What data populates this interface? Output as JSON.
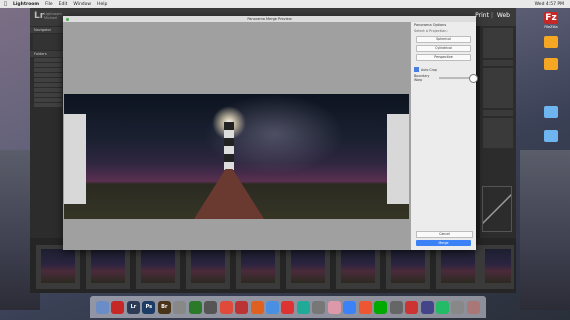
{
  "menubar": {
    "apple": "",
    "items": [
      "Lightroom",
      "File",
      "Edit",
      "Window",
      "Help"
    ],
    "clock": "Wed 4:57 PM"
  },
  "lightroom": {
    "logo": "Lr",
    "user_line1": "Lightroom",
    "user_line2": "Michael",
    "modules": [
      "Print",
      "Web"
    ],
    "left_panel": {
      "navigator": "Navigator",
      "folders": "Folders"
    }
  },
  "dialog": {
    "title": "Panorama Merge Preview",
    "options_heading": "Panorama Options",
    "projection_label": "Select a Projection:",
    "projections": [
      "Spherical",
      "Cylindrical",
      "Perspective"
    ],
    "auto_crop_label": "Auto Crop",
    "boundary_warp_label": "Boundary Warp",
    "cancel_label": "Cancel",
    "merge_label": "Merge"
  },
  "desktop_icons": [
    {
      "name": "FileZilla",
      "color": "#c62828"
    },
    {
      "name": "",
      "color": "#f5a623"
    },
    {
      "name": "",
      "color": "#f5a623"
    },
    {
      "name": "",
      "color": "#6fb6f0"
    },
    {
      "name": "",
      "color": "#6fb6f0"
    }
  ],
  "dock": [
    {
      "label": "",
      "color": "#6a8dc7"
    },
    {
      "label": "",
      "color": "#c62828"
    },
    {
      "label": "Lr",
      "color": "#2b3a55"
    },
    {
      "label": "Ps",
      "color": "#1c3c66"
    },
    {
      "label": "Br",
      "color": "#4a3417"
    },
    {
      "label": "",
      "color": "#888"
    },
    {
      "label": "",
      "color": "#2a7a2a"
    },
    {
      "label": "",
      "color": "#555"
    },
    {
      "label": "",
      "color": "#e04a3a"
    },
    {
      "label": "",
      "color": "#b33"
    },
    {
      "label": "",
      "color": "#e06020"
    },
    {
      "label": "",
      "color": "#4a90e2"
    },
    {
      "label": "",
      "color": "#d33"
    },
    {
      "label": "",
      "color": "#2a9"
    },
    {
      "label": "",
      "color": "#777"
    },
    {
      "label": "",
      "color": "#d9a"
    },
    {
      "label": "",
      "color": "#3b82f6"
    },
    {
      "label": "",
      "color": "#e53"
    },
    {
      "label": "",
      "color": "#0a0"
    },
    {
      "label": "",
      "color": "#666"
    },
    {
      "label": "",
      "color": "#c33"
    },
    {
      "label": "",
      "color": "#448"
    },
    {
      "label": "",
      "color": "#2b6"
    },
    {
      "label": "",
      "color": "#888"
    },
    {
      "label": "",
      "color": "#a77"
    }
  ]
}
